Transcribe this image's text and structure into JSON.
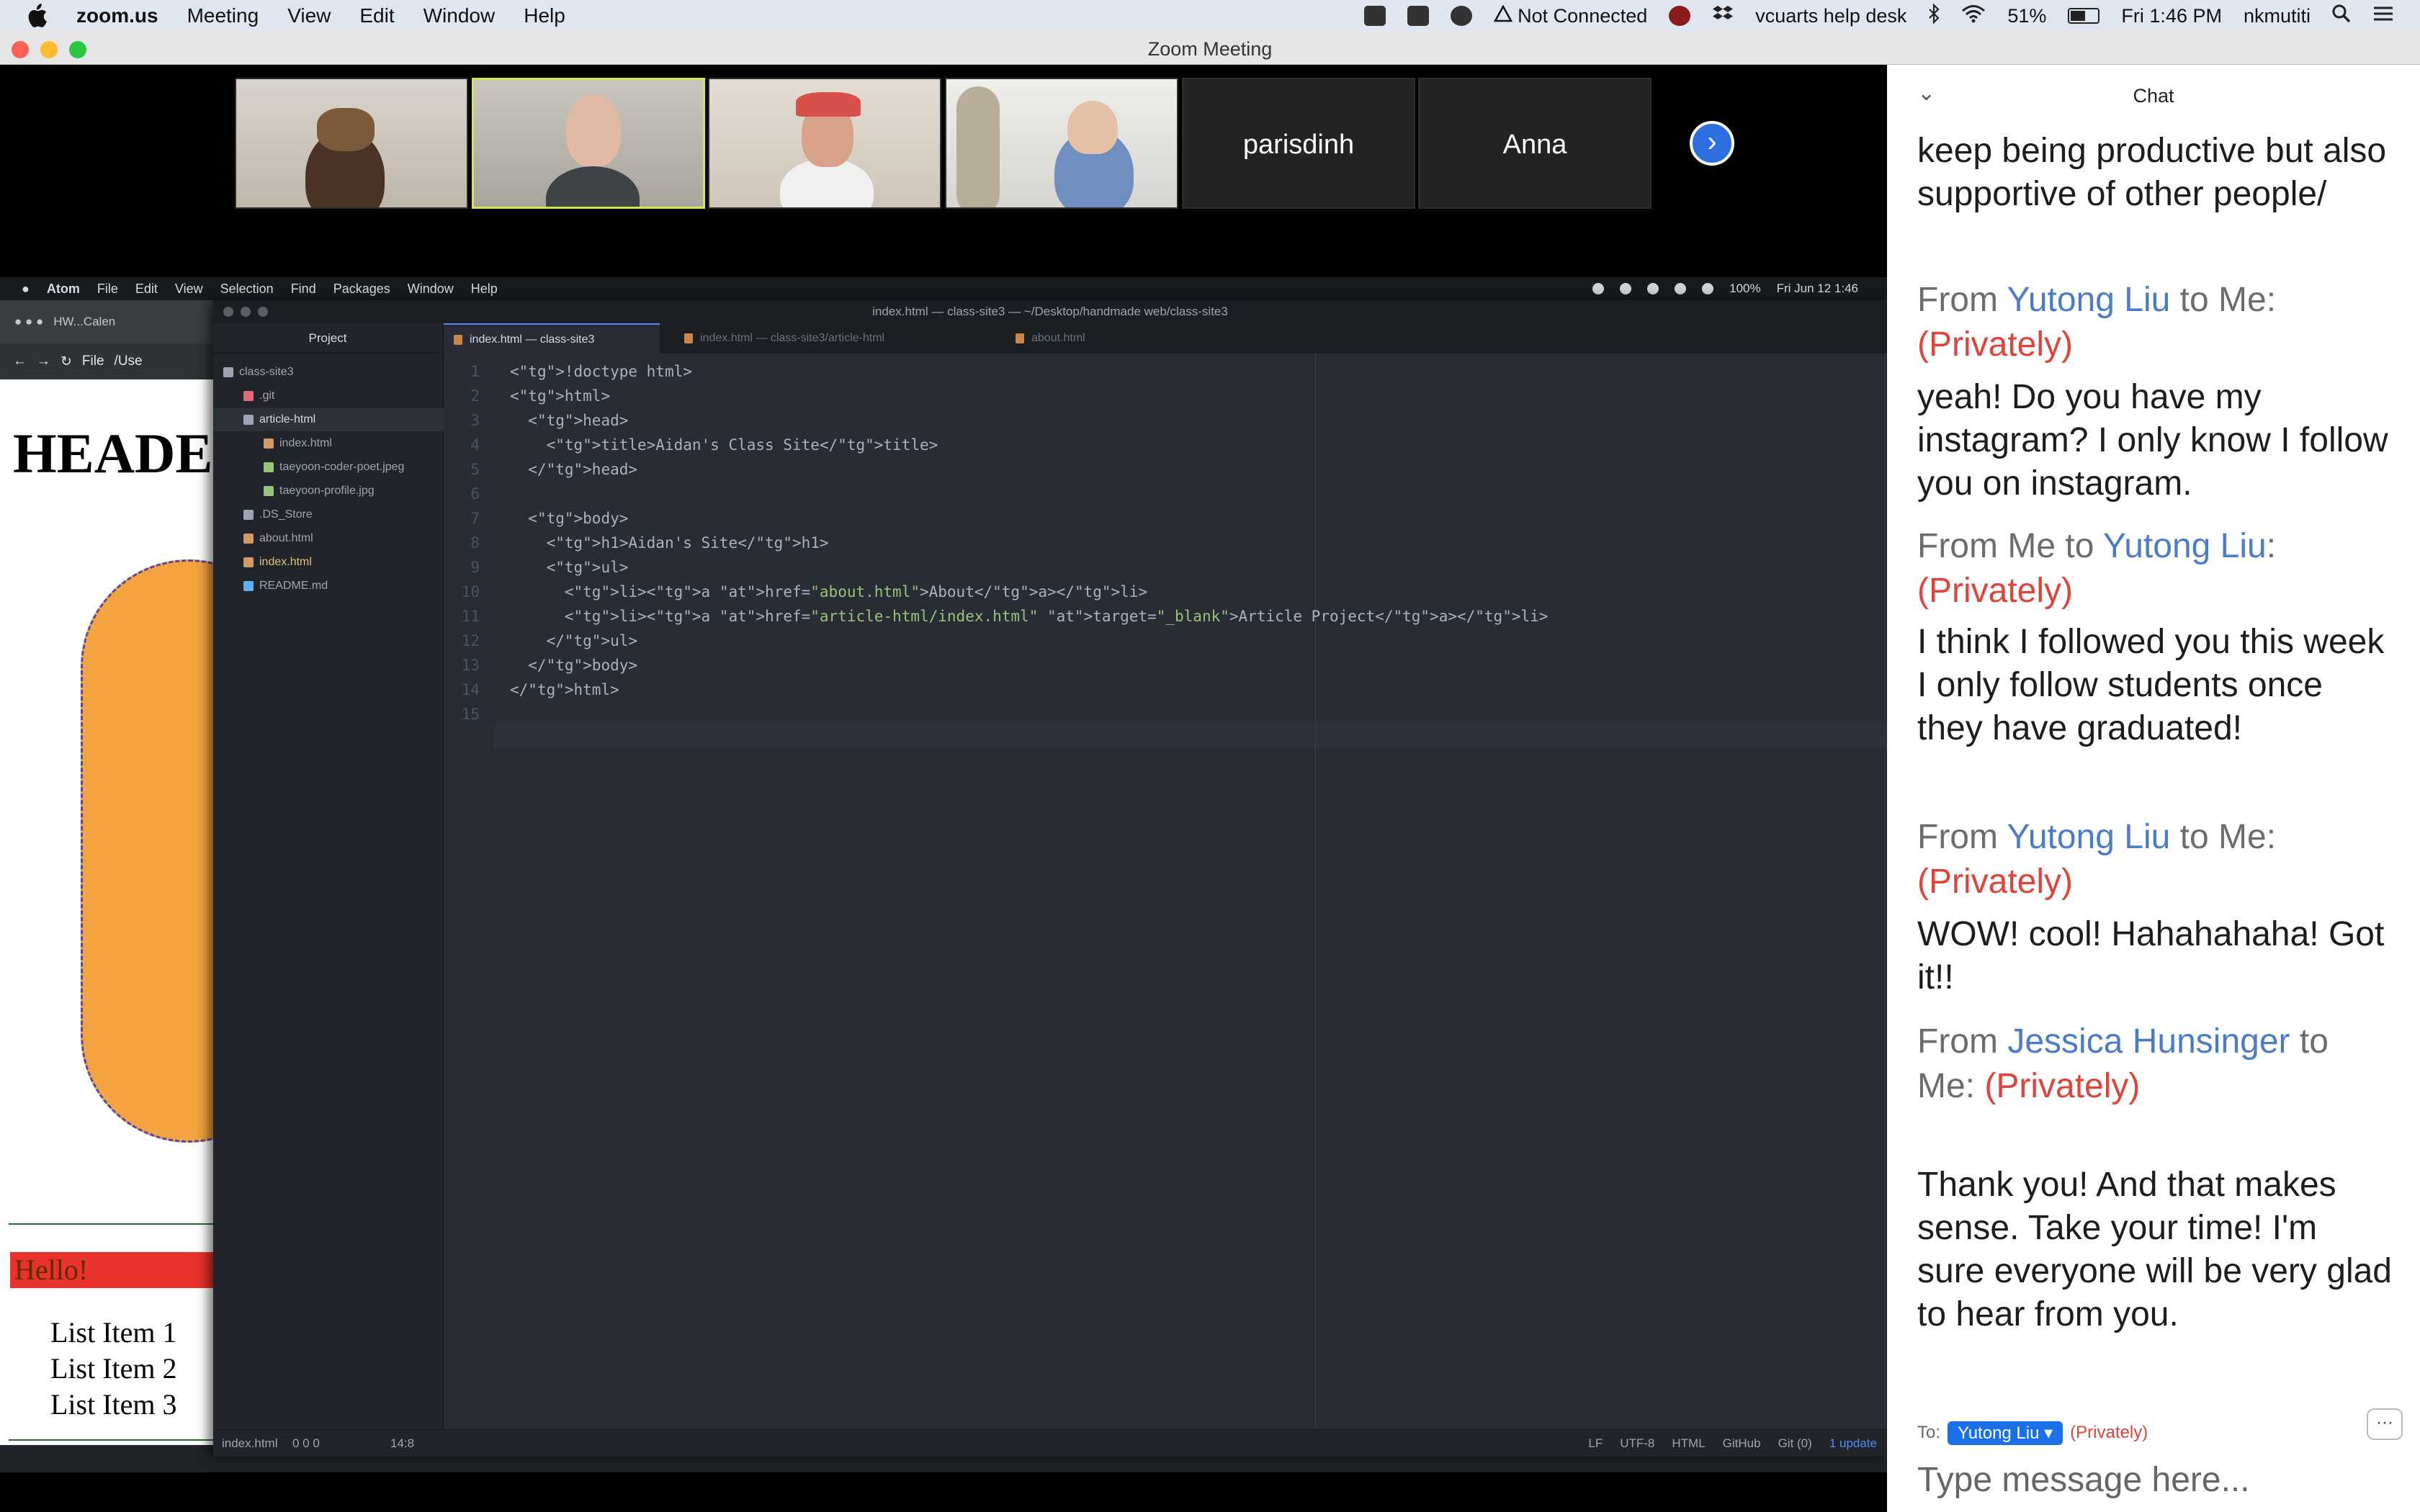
{
  "menubar": {
    "app_name": "zoom.us",
    "menus": [
      "Meeting",
      "View",
      "Edit",
      "Window",
      "Help"
    ],
    "status_not_connected": "Not Connected",
    "help_desk": "vcuarts help desk",
    "battery": "51%",
    "datetime": "Fri 1:46 PM",
    "user": "nkmutiti"
  },
  "zoom_window": {
    "title": "Zoom Meeting"
  },
  "participants": [
    {
      "type": "video"
    },
    {
      "type": "video",
      "active": true
    },
    {
      "type": "video"
    },
    {
      "type": "video"
    },
    {
      "type": "name",
      "name": "parisdinh"
    },
    {
      "type": "name",
      "name": "Anna"
    }
  ],
  "atom_menubar": {
    "app": "Atom",
    "menus": [
      "File",
      "Edit",
      "View",
      "Selection",
      "Find",
      "Packages",
      "Window",
      "Help"
    ],
    "battery": "100%",
    "datetime": "Fri Jun 12  1:46"
  },
  "browser": {
    "tab": "HW...Calen",
    "file_label": "File",
    "path": "/Use",
    "heading": "HEADE",
    "hello": "Hello!",
    "list": [
      "List Item 1",
      "List Item 2",
      "List Item 3"
    ]
  },
  "atom": {
    "window_title": "index.html — class-site3 — ~/Desktop/handmade web/class-site3",
    "tree_header": "Project",
    "tree": [
      {
        "label": "class-site3",
        "indent": 0,
        "kind": "root"
      },
      {
        "label": ".git",
        "indent": 1,
        "kind": "git"
      },
      {
        "label": "article-html",
        "indent": 1,
        "kind": "folder",
        "selected": true
      },
      {
        "label": "index.html",
        "indent": 2,
        "kind": "html"
      },
      {
        "label": "taeyoon-coder-poet.jpeg",
        "indent": 2,
        "kind": "img"
      },
      {
        "label": "taeyoon-profile.jpg",
        "indent": 2,
        "kind": "img"
      },
      {
        "label": ".DS_Store",
        "indent": 1,
        "kind": "file"
      },
      {
        "label": "about.html",
        "indent": 1,
        "kind": "html"
      },
      {
        "label": "index.html",
        "indent": 1,
        "kind": "html-active"
      },
      {
        "label": "README.md",
        "indent": 1,
        "kind": "md"
      }
    ],
    "tabs": [
      {
        "label": "index.html — class-site3",
        "active": true
      },
      {
        "label": "index.html — class-site3/article-html",
        "active": false
      },
      {
        "label": "about.html",
        "active": false
      }
    ],
    "code_lines": [
      "<!doctype html>",
      "<html>",
      "  <head>",
      "    <title>Aidan's Class Site</title>",
      "  </head>",
      "",
      "  <body>",
      "    <h1>Aidan's Site</h1>",
      "    <ul>",
      "      <li><a href=\"about.html\">About</a></li>",
      "      <li><a href=\"article-html/index.html\" target=\"_blank\">Article Project</a></li>",
      "    </ul>",
      "  </body>",
      "</html>",
      ""
    ],
    "status": {
      "file": "index.html",
      "diagnostics": "0  0  0",
      "cursor": "14:8",
      "line_ending": "LF",
      "encoding": "UTF-8",
      "grammar": "HTML",
      "github": "GitHub",
      "git": "Git (0)",
      "update": "1 update"
    }
  },
  "chat": {
    "title": "Chat",
    "messages": [
      {
        "text": "keep being productive but also supportive of other people/"
      },
      {
        "from": "Yutong Liu",
        "to": "Me",
        "private": "(Privately)",
        "text": "yeah! Do you have my instagram? I only know I follow you on instagram."
      },
      {
        "from": "Me",
        "to": "Yutong Liu",
        "private": "(Privately)",
        "text": "I think I followed you this week\nI only follow students once they have graduated!"
      },
      {
        "from": "Yutong Liu",
        "to": "Me",
        "private": "(Privately)",
        "text": "WOW! cool! Hahahahaha! Got it!!"
      },
      {
        "from": "Jessica Hunsinger",
        "to": "Me",
        "private": "(Privately)",
        "text": "Thank you! And that makes sense. Take your time! I'm sure everyone will be very glad to hear from you."
      }
    ],
    "to_label": "To:",
    "recipient": "Yutong Liu",
    "recipient_mode": "(Privately)",
    "more_label": "···",
    "input_placeholder": "Type message here..."
  }
}
